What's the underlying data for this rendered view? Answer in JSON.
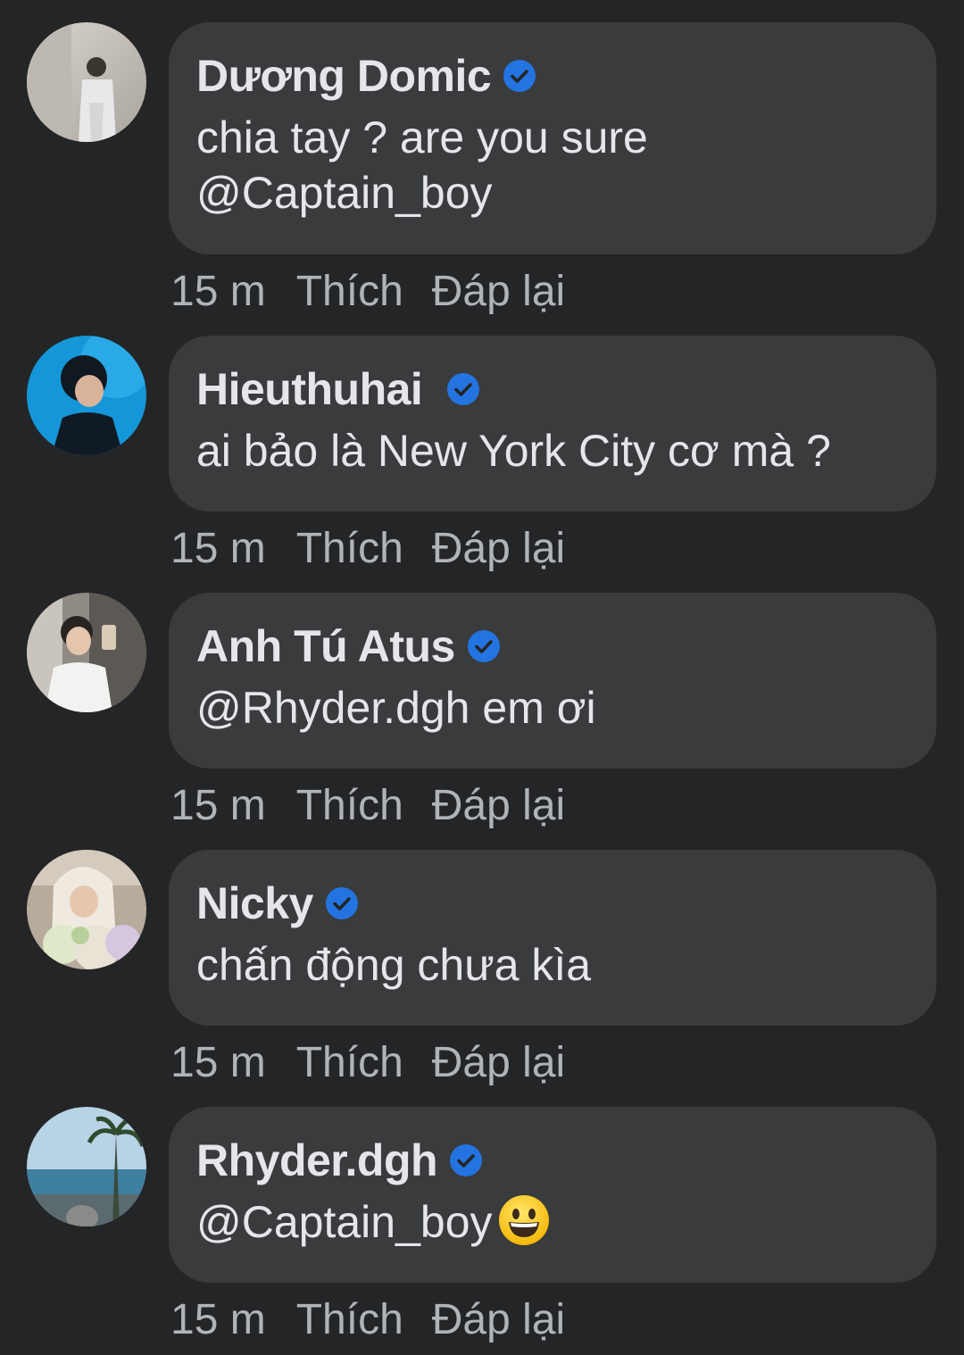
{
  "colors": {
    "background": "#242526",
    "bubble": "#3a3b3c",
    "primary_text": "#e4e6eb",
    "secondary_text": "#b0b3b8",
    "verified": "#2374e1"
  },
  "comments": [
    {
      "name": "Dương Domic",
      "verified_icon": "verified-badge-icon",
      "text": "chia tay ? are you sure\n@Captain_boy",
      "time": "15 m",
      "like_label": "Thích",
      "reply_label": "Đáp lại"
    },
    {
      "name": "Hieuthuhai",
      "verified_icon": "verified-badge-icon",
      "text": "ai bảo là New York City cơ mà ?",
      "time": "15 m",
      "like_label": "Thích",
      "reply_label": "Đáp lại"
    },
    {
      "name": "Anh Tú Atus",
      "verified_icon": "verified-badge-icon",
      "text": "@Rhyder.dgh em ơi",
      "time": "15 m",
      "like_label": "Thích",
      "reply_label": "Đáp lại"
    },
    {
      "name": "Nicky",
      "verified_icon": "verified-badge-icon",
      "text": "chấn động chưa kìa",
      "time": "15 m",
      "like_label": "Thích",
      "reply_label": "Đáp lại"
    },
    {
      "name": "Rhyder.dgh",
      "verified_icon": "verified-badge-icon",
      "text": "@Captain_boy",
      "emoji": "grinning-face-emoji",
      "time": "15 m",
      "like_label": "Thích",
      "reply_label": "Đáp lại"
    }
  ]
}
